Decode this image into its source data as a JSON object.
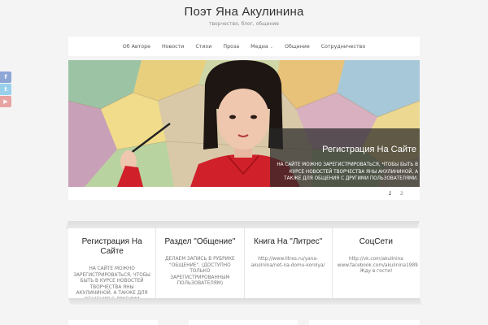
{
  "header": {
    "title": "Поэт Яна Акулинина",
    "tagline": "творчество, блог, общение"
  },
  "nav": {
    "items": [
      "Об Авторе",
      "Новости",
      "Стихи",
      "Проза",
      "Медиа",
      "Общение",
      "Сотрудничество"
    ],
    "media_caret": "v"
  },
  "social": {
    "icons": [
      "facebook-icon",
      "twitter-icon",
      "youtube-icon"
    ]
  },
  "slider": {
    "caption_title": "Регистрация На Сайте",
    "caption_text": "На сайте можно зарегистрироваться, чтобы быть в курсе новостей творчества Яны Акулининой, а также для общения с другими пользователями.",
    "pages": [
      "1",
      "2"
    ],
    "active_page": "1"
  },
  "cards": [
    {
      "title": "Регистрация На Сайте",
      "text": "На сайте можно зарегистрироваться, чтобы быть в курсе новостей творчества Яны Акулининой, а также для общения с другими"
    },
    {
      "title": "Раздел \"Общение\"",
      "text": "Делаем запись в рубрике \"Общение\". (Доступно только зарегистрированным пользователям)"
    },
    {
      "title": "Книга На \"Литрес\"",
      "text": "http://www.litres.ru/yana-akulinina/net-na-domu-korolya/"
    },
    {
      "title": "СоцСети",
      "text": "http://vk.com/akulinina\nwww.facebook.com/akulinina1989\nЖду в гости!"
    }
  ]
}
